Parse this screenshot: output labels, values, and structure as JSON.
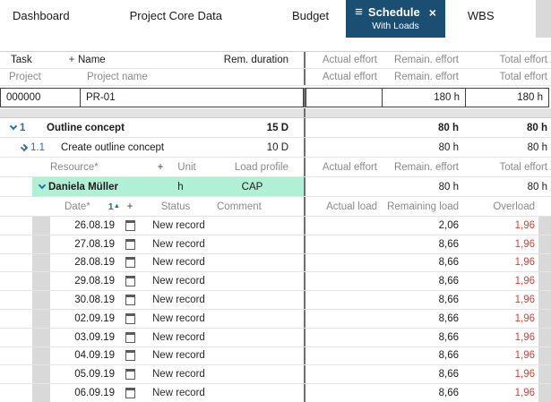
{
  "colors": {
    "active_tab_navy": "#1a4e72",
    "selected_row_green": "#b2f0d6",
    "overload_red": "#e03a2f",
    "accent_blue": "#2272ab"
  },
  "icons": {
    "menu": "≡",
    "close": "×",
    "plus": "+",
    "sort_asc": "▲"
  },
  "tabs": [
    {
      "label": "Dashboard"
    },
    {
      "label": "Project Core Data"
    },
    {
      "label": "Budget"
    },
    {
      "label": "Schedule",
      "sublabel": "With Loads",
      "active": true
    },
    {
      "label": "WBS"
    }
  ],
  "task_header": {
    "task": "Task",
    "name": "Name",
    "rem_duration": "Rem. duration",
    "actual_effort": "Actual effort",
    "remain_effort": "Remain. effort",
    "total_effort": "Total effort"
  },
  "project_header": {
    "project": "Project",
    "project_name": "Project name",
    "actual_effort": "Actual effort",
    "remain_effort": "Remain. effort",
    "total_effort": "Total effort"
  },
  "project_row": {
    "id": "000000",
    "name": "PR-01",
    "actual_effort": "",
    "remain_effort": "180 h",
    "total_effort": "180 h"
  },
  "tasks": [
    {
      "num": "1",
      "name": "Outline concept",
      "duration": "15 D",
      "actual_effort": "",
      "remain_effort": "80 h",
      "total_effort": "80 h"
    },
    {
      "num": "1.1",
      "name": "Create outline concept",
      "duration": "10 D",
      "actual_effort": "",
      "remain_effort": "80 h",
      "total_effort": "80 h"
    }
  ],
  "resource_header": {
    "resource": "Resource*",
    "unit": "Unit",
    "load_profile": "Load profile",
    "actual_effort": "Actual effort",
    "remain_effort": "Remain. effort",
    "total_effort": "Total effort"
  },
  "resource_row": {
    "name": "Daniela Müller",
    "unit": "h",
    "load_profile": "CAP",
    "actual_effort": "",
    "remain_effort": "80 h",
    "total_effort": "80 h"
  },
  "load_header": {
    "date": "Date*",
    "sort_num": "1",
    "status": "Status",
    "comment": "Comment",
    "actual_load": "Actual load",
    "remaining_load": "Remaining load",
    "overload": "Overload"
  },
  "load_rows": [
    {
      "date": "26.08.19",
      "status": "New record",
      "comment": "",
      "actual_load": "",
      "remaining_load": "2,06",
      "overload": "1,96"
    },
    {
      "date": "27.08.19",
      "status": "New record",
      "comment": "",
      "actual_load": "",
      "remaining_load": "8,66",
      "overload": "1,96"
    },
    {
      "date": "28.08.19",
      "status": "New record",
      "comment": "",
      "actual_load": "",
      "remaining_load": "8,66",
      "overload": "1,96"
    },
    {
      "date": "29.08.19",
      "status": "New record",
      "comment": "",
      "actual_load": "",
      "remaining_load": "8,66",
      "overload": "1,96"
    },
    {
      "date": "30.08.19",
      "status": "New record",
      "comment": "",
      "actual_load": "",
      "remaining_load": "8,66",
      "overload": "1,96"
    },
    {
      "date": "02.09.19",
      "status": "New record",
      "comment": "",
      "actual_load": "",
      "remaining_load": "8,66",
      "overload": "1,96"
    },
    {
      "date": "03.09.19",
      "status": "New record",
      "comment": "",
      "actual_load": "",
      "remaining_load": "8,66",
      "overload": "1,96"
    },
    {
      "date": "04.09.19",
      "status": "New record",
      "comment": "",
      "actual_load": "",
      "remaining_load": "8,66",
      "overload": "1,96"
    },
    {
      "date": "05.09.19",
      "status": "New record",
      "comment": "",
      "actual_load": "",
      "remaining_load": "8,66",
      "overload": "1,96"
    },
    {
      "date": "06.09.19",
      "status": "New record",
      "comment": "",
      "actual_load": "",
      "remaining_load": "8,66",
      "overload": "1,96"
    }
  ]
}
